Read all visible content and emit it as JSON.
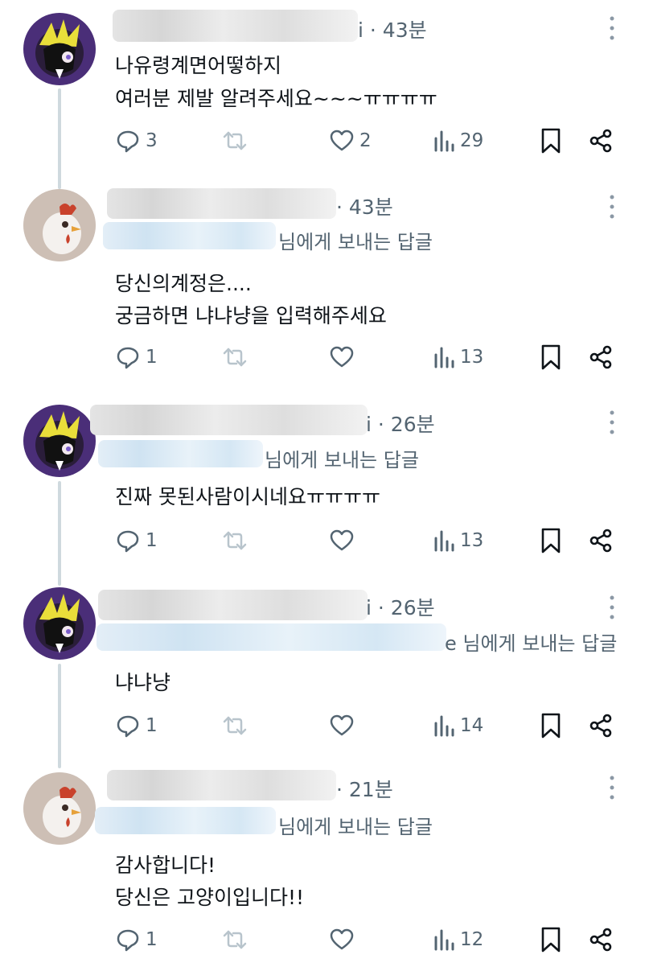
{
  "posts": [
    {
      "time": "i · 43분",
      "reply_to": "",
      "lines": [
        "나유령계면어떻하지",
        "여러분 제발 알려주세요~~~ㅠㅠㅠㅠ"
      ],
      "counts": {
        "reply": "3",
        "retweet": "",
        "like": "2",
        "views": "29"
      },
      "avatar": "purple-character",
      "like_icon": "heart-icon"
    },
    {
      "time": "· 43분",
      "reply_to": "님에게 보내는 답글",
      "lines": [
        "당신의계정은....",
        "궁금하면 냐냐냥을 입력해주세요"
      ],
      "counts": {
        "reply": "1",
        "retweet": "",
        "like": "",
        "views": "13"
      },
      "avatar": "chicken"
    },
    {
      "time": "i · 26분",
      "reply_to": "님에게 보내는 답글",
      "lines": [
        "진짜 못된사람이시네요ㅠㅠㅠㅠ"
      ],
      "counts": {
        "reply": "1",
        "retweet": "",
        "like": "",
        "views": "13"
      },
      "avatar": "purple-character"
    },
    {
      "time": "i · 26분",
      "reply_to": "e 님에게 보내는 답글",
      "lines": [
        "냐냐냥"
      ],
      "counts": {
        "reply": "1",
        "retweet": "",
        "like": "",
        "views": "14"
      },
      "avatar": "purple-character"
    },
    {
      "time": "· 21분",
      "reply_to": "님에게 보내는 답글",
      "lines": [
        "감사합니다!",
        "당신은 고양이입니다!!"
      ],
      "counts": {
        "reply": "1",
        "retweet": "",
        "like": "",
        "views": "12"
      },
      "avatar": "chicken"
    }
  ],
  "colors": {
    "text": "#0f1419",
    "secondary": "#536471",
    "thread_line": "#cfd9de"
  }
}
